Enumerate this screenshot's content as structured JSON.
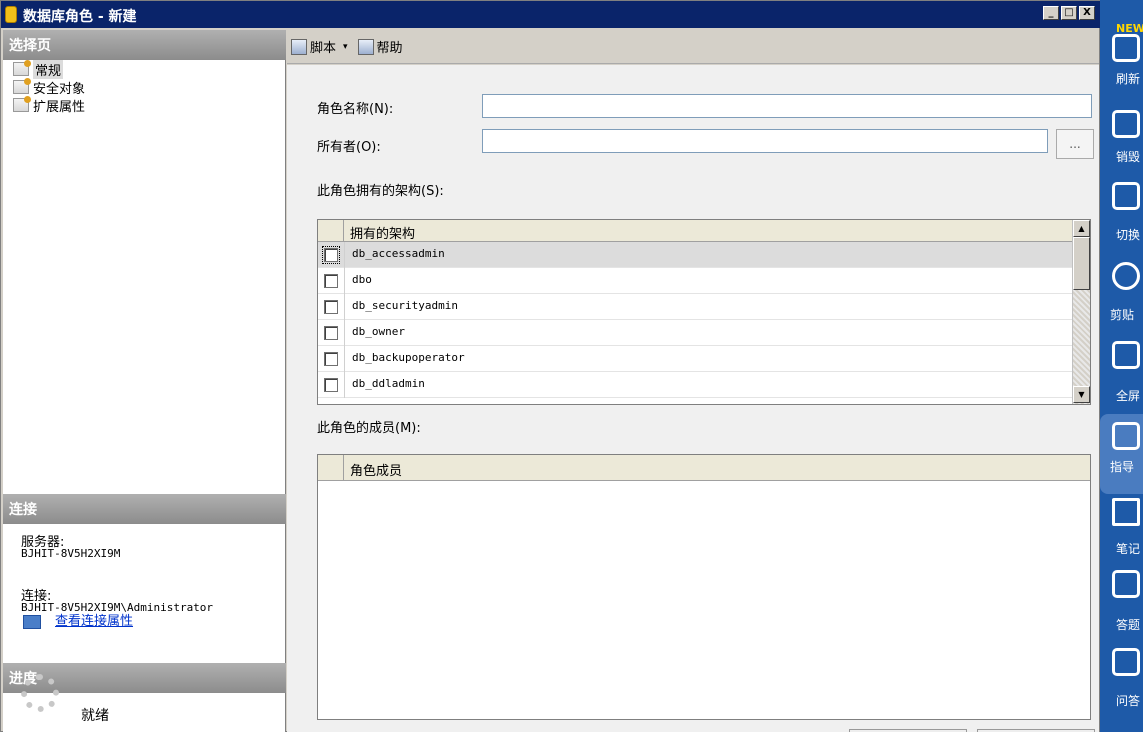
{
  "window": {
    "title": "数据库角色 - 新建",
    "buttons": [
      "_",
      "□",
      "X"
    ]
  },
  "left": {
    "select_page_header": "选择页",
    "pages": [
      "常规",
      "安全对象",
      "扩展属性"
    ],
    "connection_header": "连接",
    "server_label": "服务器:",
    "server_value": "BJHIT-8V5H2XI9M",
    "connection_label": "连接:",
    "connection_value": "BJHIT-8V5H2XI9M\\Administrator",
    "view_link": "查看连接属性",
    "progress_header": "进度",
    "progress_status": "就绪"
  },
  "toolbar": {
    "script_label": "脚本",
    "dropdown_arrow": "▾",
    "help_label": "帮助"
  },
  "form": {
    "role_name_label": "角色名称(N):",
    "role_name_value": "",
    "owner_label": "所有者(O):",
    "owner_value": "",
    "browse_label": "...",
    "schemas_label": "此角色拥有的架构(S):",
    "schemas_header": "拥有的架构",
    "schemas": [
      {
        "name": "db_accessadmin",
        "checked": false
      },
      {
        "name": "dbo",
        "checked": false
      },
      {
        "name": "db_securityadmin",
        "checked": false
      },
      {
        "name": "db_owner",
        "checked": false
      },
      {
        "name": "db_backupoperator",
        "checked": false
      },
      {
        "name": "db_ddladmin",
        "checked": false
      }
    ],
    "members_label": "此角色的成员(M):",
    "members_header": "角色成员"
  },
  "sidebar": {
    "new_tag": "NEW",
    "items": [
      "刷新",
      "销毁",
      "切换",
      "剪贴",
      "全屏",
      "指导",
      "笔记",
      "答题",
      "问答"
    ]
  }
}
